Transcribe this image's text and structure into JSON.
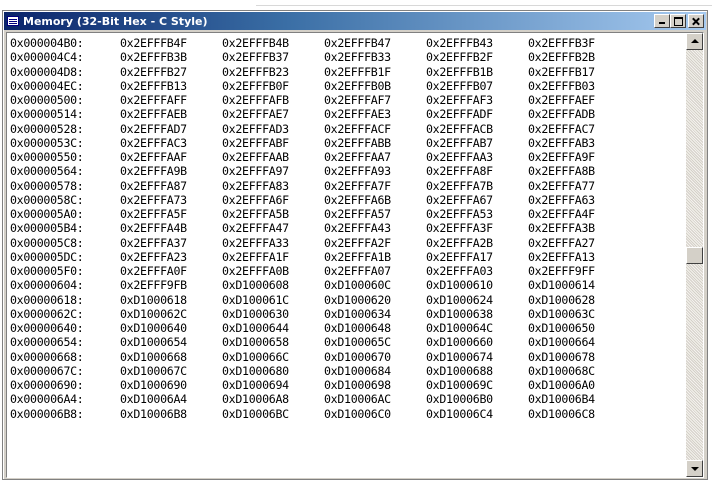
{
  "window": {
    "title": "Memory (32-Bit Hex - C Style)",
    "icon": "memory-window-icon"
  },
  "title_buttons": {
    "minimize": "minimize-icon",
    "maximize": "maximize-icon",
    "close": "close-icon"
  },
  "memory": {
    "rows": [
      {
        "address": "0x000004B0:",
        "values": [
          "0x2EFFFB4F",
          "0x2EFFFB4B",
          "0x2EFFFB47",
          "0x2EFFFB43",
          "0x2EFFFB3F"
        ]
      },
      {
        "address": "0x000004C4:",
        "values": [
          "0x2EFFFB3B",
          "0x2EFFFB37",
          "0x2EFFFB33",
          "0x2EFFFB2F",
          "0x2EFFFB2B"
        ]
      },
      {
        "address": "0x000004D8:",
        "values": [
          "0x2EFFFB27",
          "0x2EFFFB23",
          "0x2EFFFB1F",
          "0x2EFFFB1B",
          "0x2EFFFB17"
        ]
      },
      {
        "address": "0x000004EC:",
        "values": [
          "0x2EFFFB13",
          "0x2EFFFB0F",
          "0x2EFFFB0B",
          "0x2EFFFB07",
          "0x2EFFFB03"
        ]
      },
      {
        "address": "0x00000500:",
        "values": [
          "0x2EFFFAFF",
          "0x2EFFFAFB",
          "0x2EFFFAF7",
          "0x2EFFFAF3",
          "0x2EFFFAEF"
        ]
      },
      {
        "address": "0x00000514:",
        "values": [
          "0x2EFFFAEB",
          "0x2EFFFAE7",
          "0x2EFFFAE3",
          "0x2EFFFADF",
          "0x2EFFFADB"
        ]
      },
      {
        "address": "0x00000528:",
        "values": [
          "0x2EFFFAD7",
          "0x2EFFFAD3",
          "0x2EFFFACF",
          "0x2EFFFACB",
          "0x2EFFFAC7"
        ]
      },
      {
        "address": "0x0000053C:",
        "values": [
          "0x2EFFFAC3",
          "0x2EFFFABF",
          "0x2EFFFABB",
          "0x2EFFFAB7",
          "0x2EFFFAB3"
        ]
      },
      {
        "address": "0x00000550:",
        "values": [
          "0x2EFFFAAF",
          "0x2EFFFAAB",
          "0x2EFFFAA7",
          "0x2EFFFAA3",
          "0x2EFFFA9F"
        ]
      },
      {
        "address": "0x00000564:",
        "values": [
          "0x2EFFFA9B",
          "0x2EFFFA97",
          "0x2EFFFA93",
          "0x2EFFFA8F",
          "0x2EFFFA8B"
        ]
      },
      {
        "address": "0x00000578:",
        "values": [
          "0x2EFFFA87",
          "0x2EFFFA83",
          "0x2EFFFA7F",
          "0x2EFFFA7B",
          "0x2EFFFA77"
        ]
      },
      {
        "address": "0x0000058C:",
        "values": [
          "0x2EFFFA73",
          "0x2EFFFA6F",
          "0x2EFFFA6B",
          "0x2EFFFA67",
          "0x2EFFFA63"
        ]
      },
      {
        "address": "0x000005A0:",
        "values": [
          "0x2EFFFA5F",
          "0x2EFFFA5B",
          "0x2EFFFA57",
          "0x2EFFFA53",
          "0x2EFFFA4F"
        ]
      },
      {
        "address": "0x000005B4:",
        "values": [
          "0x2EFFFA4B",
          "0x2EFFFA47",
          "0x2EFFFA43",
          "0x2EFFFA3F",
          "0x2EFFFA3B"
        ]
      },
      {
        "address": "0x000005C8:",
        "values": [
          "0x2EFFFA37",
          "0x2EFFFA33",
          "0x2EFFFA2F",
          "0x2EFFFA2B",
          "0x2EFFFA27"
        ]
      },
      {
        "address": "0x000005DC:",
        "values": [
          "0x2EFFFA23",
          "0x2EFFFA1F",
          "0x2EFFFA1B",
          "0x2EFFFA17",
          "0x2EFFFA13"
        ]
      },
      {
        "address": "0x000005F0:",
        "values": [
          "0x2EFFFA0F",
          "0x2EFFFA0B",
          "0x2EFFFA07",
          "0x2EFFFA03",
          "0x2EFFF9FF"
        ]
      },
      {
        "address": "0x00000604:",
        "values": [
          "0x2EFFF9FB",
          "0xD1000608",
          "0xD100060C",
          "0xD1000610",
          "0xD1000614"
        ]
      },
      {
        "address": "0x00000618:",
        "values": [
          "0xD1000618",
          "0xD100061C",
          "0xD1000620",
          "0xD1000624",
          "0xD1000628"
        ]
      },
      {
        "address": "0x0000062C:",
        "values": [
          "0xD100062C",
          "0xD1000630",
          "0xD1000634",
          "0xD1000638",
          "0xD100063C"
        ]
      },
      {
        "address": "0x00000640:",
        "values": [
          "0xD1000640",
          "0xD1000644",
          "0xD1000648",
          "0xD100064C",
          "0xD1000650"
        ]
      },
      {
        "address": "0x00000654:",
        "values": [
          "0xD1000654",
          "0xD1000658",
          "0xD100065C",
          "0xD1000660",
          "0xD1000664"
        ]
      },
      {
        "address": "0x00000668:",
        "values": [
          "0xD1000668",
          "0xD100066C",
          "0xD1000670",
          "0xD1000674",
          "0xD1000678"
        ]
      },
      {
        "address": "0x0000067C:",
        "values": [
          "0xD100067C",
          "0xD1000680",
          "0xD1000684",
          "0xD1000688",
          "0xD100068C"
        ]
      },
      {
        "address": "0x00000690:",
        "values": [
          "0xD1000690",
          "0xD1000694",
          "0xD1000698",
          "0xD100069C",
          "0xD10006A0"
        ]
      },
      {
        "address": "0x000006A4:",
        "values": [
          "0xD10006A4",
          "0xD10006A8",
          "0xD10006AC",
          "0xD10006B0",
          "0xD10006B4"
        ]
      },
      {
        "address": "0x000006B8:",
        "values": [
          "0xD10006B8",
          "0xD10006BC",
          "0xD10006C0",
          "0xD10006C4",
          "0xD10006C8"
        ]
      }
    ]
  },
  "scrollbar": {
    "up_icon": "scroll-up-arrow-icon",
    "down_icon": "scroll-down-arrow-icon",
    "thumb_position_fraction": 0.5
  },
  "colors": {
    "titlebar_start": "#0a246a",
    "titlebar_end": "#a6caf0",
    "window_face": "#d4d0c8",
    "text": "#000000"
  }
}
